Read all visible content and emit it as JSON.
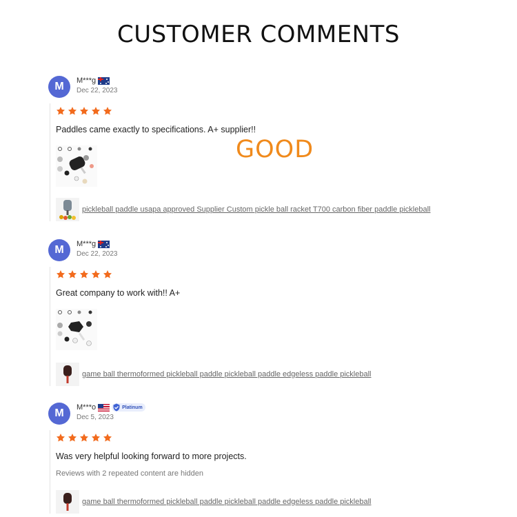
{
  "page": {
    "title": "CUSTOMER COMMENTS"
  },
  "overlay_text": "GOOD",
  "colors": {
    "accent": "#f26b1d",
    "avatar": "#5468d4",
    "badge": "#2f4fb8"
  },
  "reviews": [
    {
      "avatar_letter": "M",
      "name": "M***g",
      "country_flag": "australia-flag-icon",
      "date": "Dec 22, 2023",
      "stars": 5,
      "comment": "Paddles came exactly to specifications. A+ supplier!!",
      "product_link": "pickleball paddle usapa approved Supplier Custom pickle ball racket T700 carbon fiber paddle pickleball"
    },
    {
      "avatar_letter": "M",
      "name": "M***g",
      "country_flag": "australia-flag-icon",
      "date": "Dec 22, 2023",
      "stars": 5,
      "comment": "Great company to work with!! A+",
      "product_link": "game ball thermoformed pickleball paddle pickleball paddle edgeless paddle pickleball"
    },
    {
      "avatar_letter": "M",
      "name": "M***o",
      "country_flag": "usa-flag-icon",
      "badge": "Platinum",
      "date": "Dec 5, 2023",
      "stars": 5,
      "comment": "Was very helpful looking forward to more projects.",
      "hidden_note": "Reviews with 2 repeated content are hidden",
      "product_link": "game ball thermoformed pickleball paddle pickleball paddle edgeless paddle pickleball"
    }
  ]
}
